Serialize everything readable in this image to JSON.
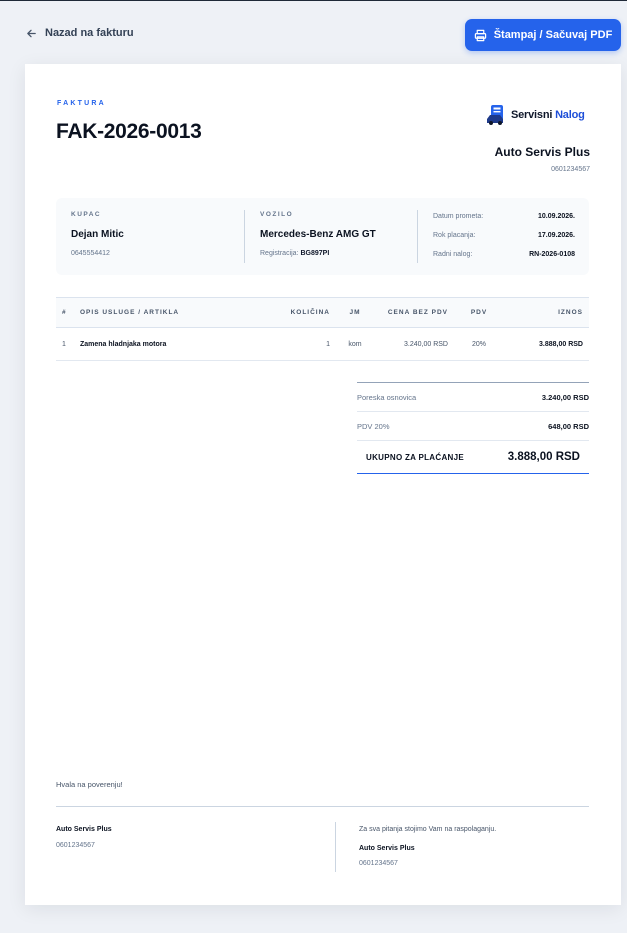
{
  "topbar": {
    "back_label": "Nazad na fakturu",
    "print_label": "Štampaj / Sačuvaj PDF"
  },
  "colors": {
    "accent": "#2563eb",
    "background": "#eef1f6"
  },
  "invoice": {
    "doc_label": "FAKTURA",
    "number": "FAK-2026-0013"
  },
  "brand": {
    "logo_word_1": "Servisni",
    "logo_word_2": "Nalog",
    "company_name": "Auto Servis Plus",
    "company_phone": "0601234567"
  },
  "customer": {
    "label": "KUPAC",
    "name": "Dejan Mitic",
    "phone": "0645554412"
  },
  "vehicle": {
    "label": "VOZILO",
    "model": "Mercedes-Benz AMG GT",
    "reg_label": "Registracija:",
    "reg_value": "BG897PI"
  },
  "dates": [
    {
      "key": "Datum prometa:",
      "value": "10.09.2026."
    },
    {
      "key": "Rok placanja:",
      "value": "17.09.2026."
    },
    {
      "key": "Radni nalog:",
      "value": "RN-2026-0108"
    }
  ],
  "table": {
    "headers": [
      "#",
      "OPIS USLUGE / ARTIKLA",
      "KOLIČINA",
      "JM",
      "CENA BEZ PDV",
      "PDV",
      "IZNOS"
    ],
    "rows": [
      [
        "1",
        "Zamena hladnjaka motora",
        "1",
        "kom",
        "3.240,00 RSD",
        "20%",
        "3.888,00 RSD"
      ]
    ]
  },
  "totals": {
    "base_label": "Poreska osnovica",
    "base_value": "3.240,00 RSD",
    "vat_label": "PDV 20%",
    "vat_value": "648,00 RSD",
    "grand_label": "UKUPNO ZA PLAĆANJE",
    "grand_value": "3.888,00 RSD"
  },
  "footer": {
    "thanks": "Hvala na poverenju!",
    "left_name": "Auto Servis Plus",
    "left_phone": "0601234567",
    "note": "Za sva pitanja stojimo Vam na raspolaganju.",
    "right_name": "Auto Servis Plus",
    "right_phone": "0601234567"
  }
}
